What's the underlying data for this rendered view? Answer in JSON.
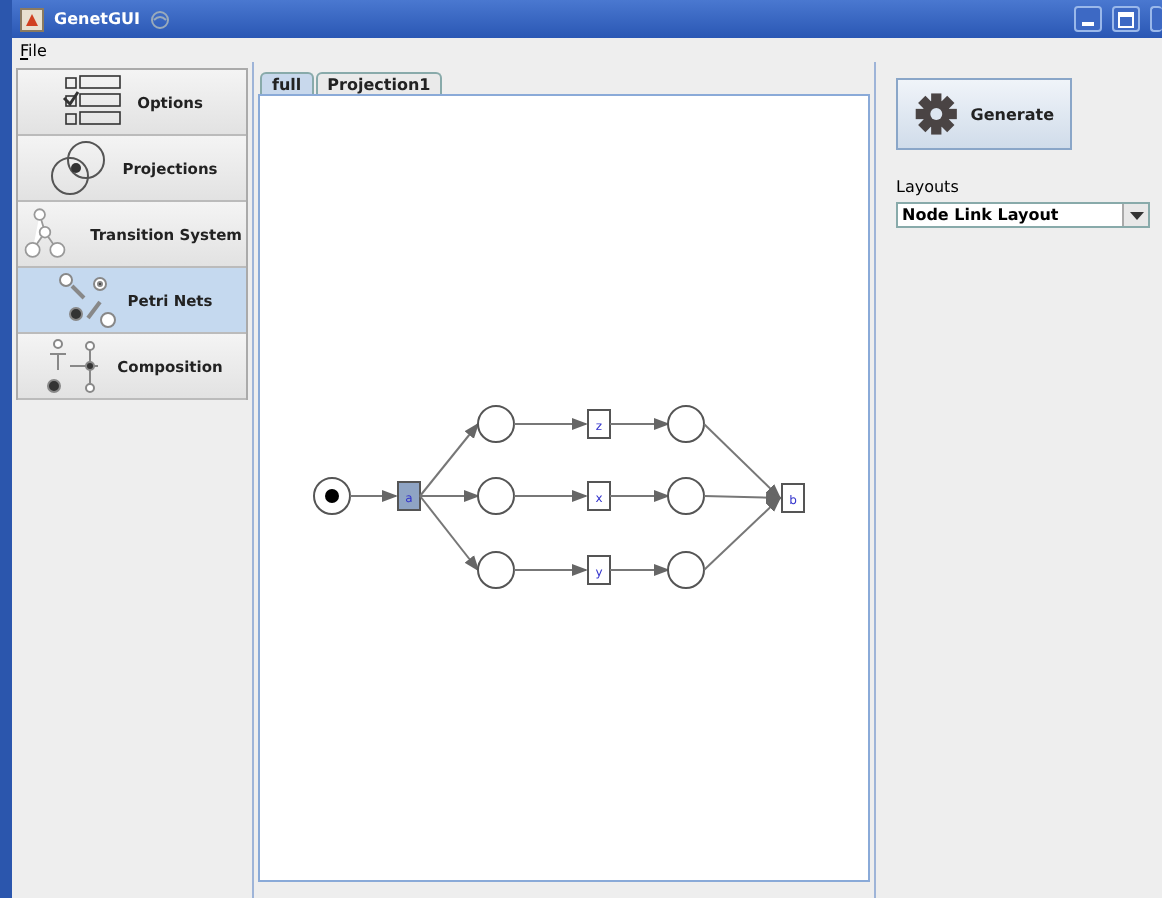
{
  "window": {
    "title": "GenetGUI"
  },
  "menu": [
    {
      "label": "File"
    }
  ],
  "sidebar": {
    "items": [
      {
        "label": "Options",
        "selected": false
      },
      {
        "label": "Projections",
        "selected": false
      },
      {
        "label": "Transition System",
        "selected": false
      },
      {
        "label": "Petri Nets",
        "selected": true
      },
      {
        "label": "Composition",
        "selected": false
      }
    ]
  },
  "tabs": [
    {
      "label": "full",
      "selected": true
    },
    {
      "label": "Projection1",
      "selected": false
    }
  ],
  "petri_net": {
    "start": {
      "token": true
    },
    "fork": {
      "label": "a",
      "selected": true
    },
    "branches": [
      {
        "label": "z"
      },
      {
        "label": "x"
      },
      {
        "label": "y"
      }
    ],
    "join": {
      "label": "b",
      "selected": false
    }
  },
  "generate_button": {
    "label": "Generate"
  },
  "layouts": {
    "label": "Layouts",
    "value": "Node Link Layout"
  }
}
